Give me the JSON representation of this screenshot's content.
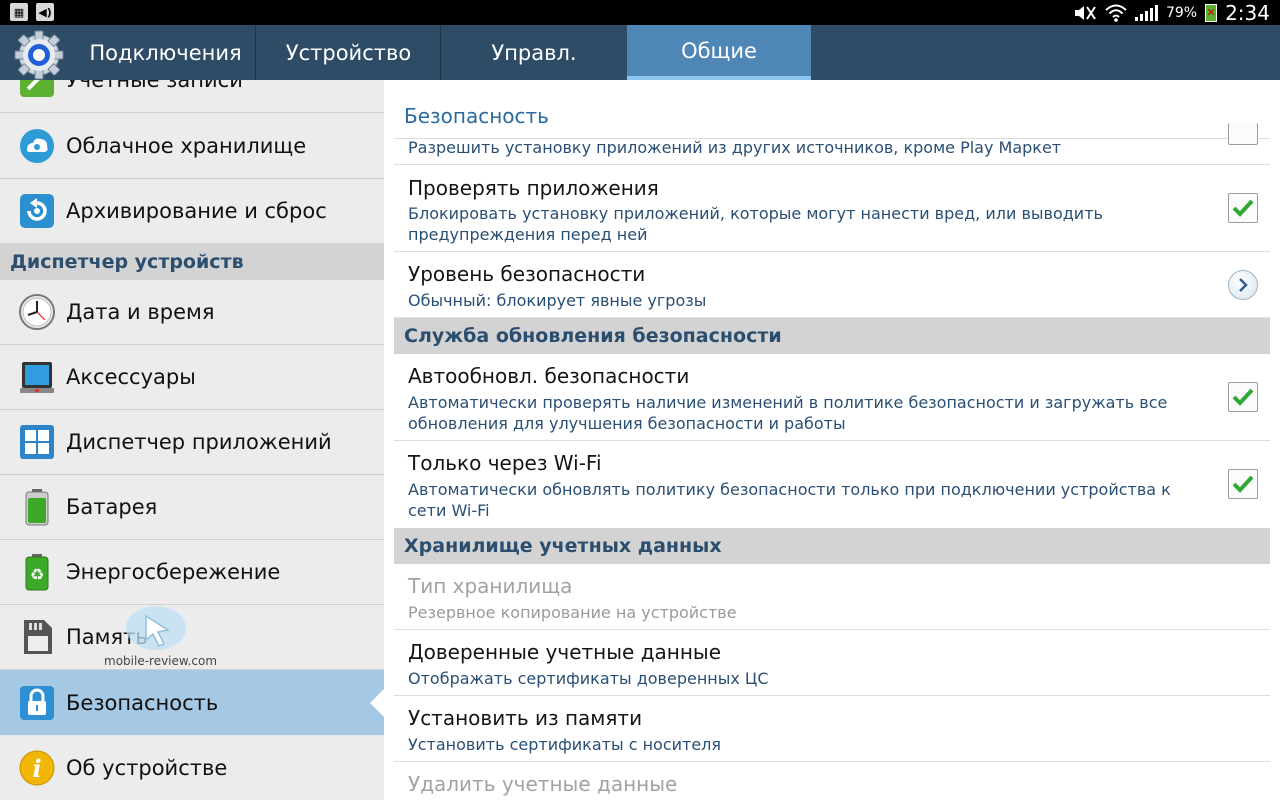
{
  "status_bar": {
    "battery": "79%",
    "time": "2:34"
  },
  "header": {
    "tabs": [
      {
        "label": "Подключения"
      },
      {
        "label": "Устройство"
      },
      {
        "label": "Управл."
      },
      {
        "label": "Общие"
      }
    ],
    "active_tab": "Общие"
  },
  "sidebar": {
    "items": [
      {
        "label": "Учетные записи"
      },
      {
        "label": "Облачное хранилище"
      },
      {
        "label": "Архивирование и сброс"
      },
      {
        "label": "Дата и время"
      },
      {
        "label": "Аксессуары"
      },
      {
        "label": "Диспетчер приложений"
      },
      {
        "label": "Батарея"
      },
      {
        "label": "Энергосбережение"
      },
      {
        "label": "Память"
      },
      {
        "label": "Безопасность"
      },
      {
        "label": "Об устройстве"
      }
    ],
    "section_header": "Диспетчер устройств",
    "selected": "Безопасность",
    "watermark": "mobile-review.com"
  },
  "content": {
    "title": "Безопасность",
    "rows": [
      {
        "subtitle": "Разрешить установку приложений из других источников, кроме Play Маркет",
        "checked": false
      },
      {
        "title": "Проверять приложения",
        "subtitle": "Блокировать установку приложений, которые могут нанести вред, или выводить предупреждения перед ней",
        "checked": true
      },
      {
        "title": "Уровень безопасности",
        "subtitle": "Обычный: блокирует явные угрозы"
      },
      {
        "title": "Автообновл. безопасности",
        "subtitle": "Автоматически проверять наличие изменений в политике безопасности и загружать все обновления для улучшения безопасности и работы",
        "checked": true
      },
      {
        "title": "Только через Wi-Fi",
        "subtitle": "Автоматически обновлять политику безопасности только при подключении устройства к сети Wi-Fi",
        "checked": true
      },
      {
        "title": "Тип хранилища",
        "subtitle": "Резервное копирование на устройстве",
        "enabled": false
      },
      {
        "title": "Доверенные учетные данные",
        "subtitle": "Отображать сертификаты доверенных ЦС"
      },
      {
        "title": "Установить из памяти",
        "subtitle": "Установить сертификаты с носителя"
      },
      {
        "title": "Удалить учетные данные",
        "enabled": false
      }
    ],
    "sections": [
      {
        "label": "Служба обновления безопасности"
      },
      {
        "label": "Хранилище учетных данных"
      }
    ]
  },
  "colors": {
    "actionbar": "#2e4c66",
    "active_tab": "#4e86b6",
    "check": "#2fa836",
    "accent_text": "#2b6aa0"
  }
}
